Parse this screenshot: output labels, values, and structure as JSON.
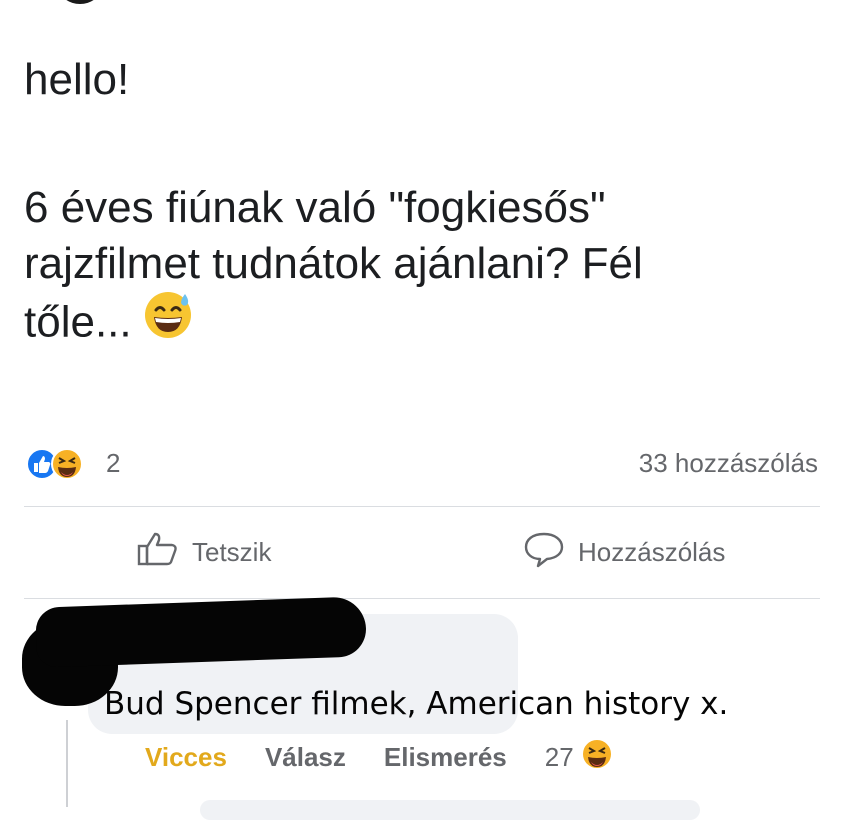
{
  "post": {
    "lines": [
      "hello!",
      "6 éves fiúnak való \"fogkiesős\"",
      "rajzfilmet tudnátok ajánlani? Fél",
      "tőle..."
    ],
    "emoji": "grinning-sweat-emoji"
  },
  "reactions": {
    "icons": [
      "like-icon",
      "haha-icon"
    ],
    "count": "2",
    "comment_count": "33 hozzászólás"
  },
  "actions": {
    "like_label": "Tetszik",
    "comment_label": "Hozzászólás"
  },
  "comment": {
    "author": "",
    "text": "Bud Spencer filmek, American history x.",
    "reaction_label": "Vicces",
    "reply_label": "Válasz",
    "recognition_label": "Elismerés",
    "reaction_count": "27",
    "reaction_icon": "haha-icon"
  },
  "colors": {
    "like_blue": "#1877f2",
    "haha_yellow": "#f7b125",
    "funny_label": "#e2a91c",
    "meta_gray": "#65676b"
  }
}
